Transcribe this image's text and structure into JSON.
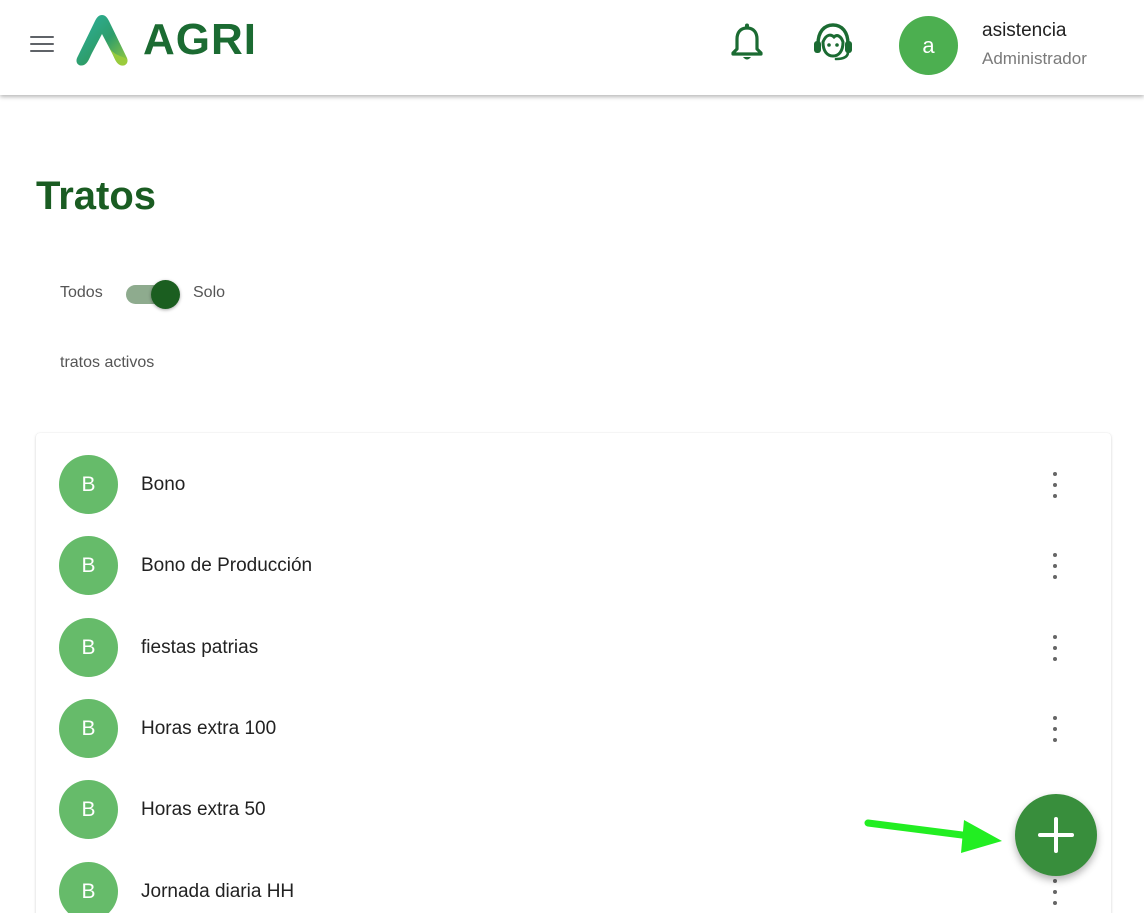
{
  "header": {
    "brand": "AGRI",
    "user_initial": "a",
    "user_name": "asistencia",
    "user_role": "Administrador"
  },
  "page": {
    "title": "Tratos"
  },
  "filter": {
    "left_label": "Todos",
    "right_label": "Solo",
    "caption": "tratos activos",
    "solo_activos_on": true
  },
  "list": {
    "items": [
      {
        "initial": "B",
        "label": "Bono"
      },
      {
        "initial": "B",
        "label": "Bono de Producción"
      },
      {
        "initial": "B",
        "label": "fiestas patrias"
      },
      {
        "initial": "B",
        "label": "Horas extra 100"
      },
      {
        "initial": "B",
        "label": "Horas extra 50"
      },
      {
        "initial": "B",
        "label": "Jornada diaria HH"
      }
    ]
  },
  "icons": {
    "menu": "hamburger-menu-icon",
    "notifications": "bell-icon",
    "support": "headset-support-icon",
    "item_actions": "more-vert-icon",
    "fab": "plus-icon"
  },
  "colors": {
    "brand_green": "#1b6b32",
    "title_green": "#1a5c22",
    "avatar_green": "#4caf50",
    "item_avatar_green": "#66bb6a",
    "fab_green": "#388e3c",
    "annotation_arrow": "#22ee22"
  }
}
